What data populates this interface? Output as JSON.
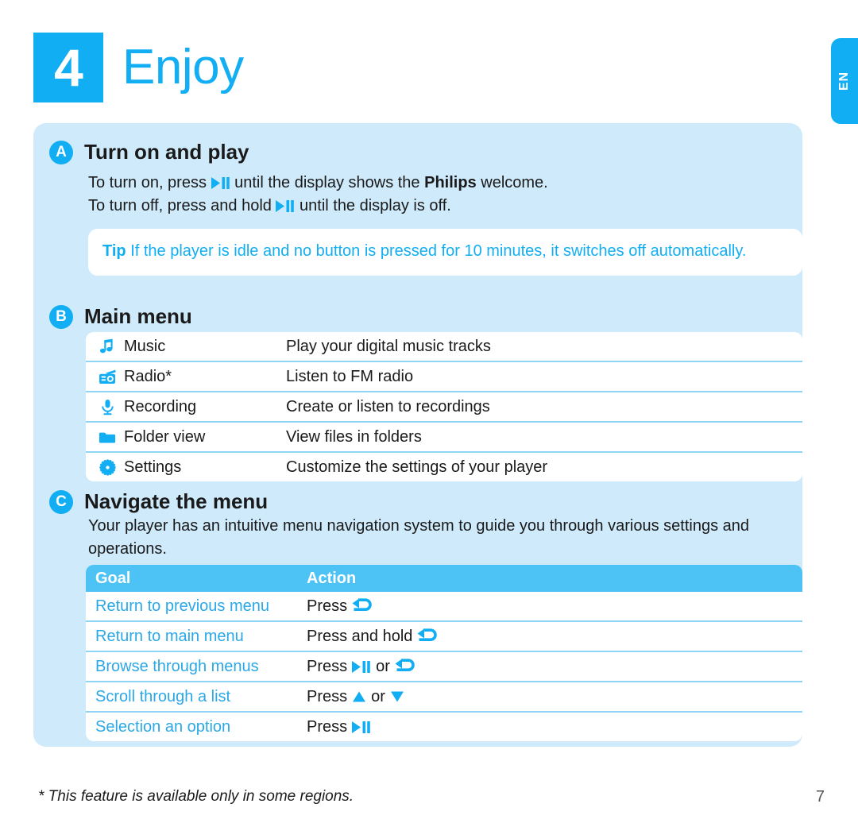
{
  "chapter": {
    "number": "4",
    "title": "Enjoy"
  },
  "language_tab": {
    "label": "EN"
  },
  "sections": {
    "a": {
      "badge": "A",
      "title": "Turn on and play",
      "line1_part1": "To turn on, press ",
      "line1_part2": " until the display shows the ",
      "line1_brand": "Philips",
      "line1_part3": " welcome.",
      "line2_part1": "To turn off, press and hold ",
      "line2_part2": " until the display is off."
    },
    "tip": {
      "label": "Tip",
      "text": " If the player is idle and no button is pressed for 10 minutes, it switches off automatically."
    },
    "b": {
      "badge": "B",
      "title": "Main menu",
      "rows": [
        {
          "icon": "music-note-icon",
          "label": "Music",
          "desc": "Play your digital music tracks"
        },
        {
          "icon": "radio-icon",
          "label": "Radio*",
          "desc": "Listen to FM radio"
        },
        {
          "icon": "microphone-icon",
          "label": "Recording",
          "desc": "Create or listen to recordings"
        },
        {
          "icon": "folder-icon",
          "label": "Folder view",
          "desc": "View files in folders"
        },
        {
          "icon": "gear-icon",
          "label": "Settings",
          "desc": "Customize the settings of your player"
        }
      ]
    },
    "c": {
      "badge": "C",
      "title": "Navigate the menu",
      "intro": "Your player has an intuitive menu navigation system to guide you through various settings and operations.",
      "table": {
        "headers": {
          "goal": "Goal",
          "action": "Action"
        },
        "rows": [
          {
            "goal": "Return to previous menu",
            "action_text": "Press",
            "icons": [
              "back-arrow-icon"
            ],
            "connector": ""
          },
          {
            "goal": "Return to main menu",
            "action_text": "Press and hold",
            "icons": [
              "back-arrow-icon"
            ],
            "connector": ""
          },
          {
            "goal": "Browse through menus",
            "action_text": "Press",
            "icons": [
              "play-pause-icon",
              "back-arrow-icon"
            ],
            "connector": "or"
          },
          {
            "goal": "Scroll through a list",
            "action_text": "Press",
            "icons": [
              "up-triangle-icon",
              "down-triangle-icon"
            ],
            "connector": "or"
          },
          {
            "goal": "Selection an option",
            "action_text": "Press",
            "icons": [
              "play-pause-icon"
            ],
            "connector": ""
          }
        ]
      }
    }
  },
  "footer": {
    "note": "*  This feature is available only in some regions.",
    "page_number": "7"
  },
  "colors": {
    "brand_blue": "#12aef3",
    "panel_blue": "#cfeafb",
    "header_blue": "#4cc2f5",
    "rule_blue": "#8fd4f5",
    "link_blue": "#2aa8e8"
  }
}
